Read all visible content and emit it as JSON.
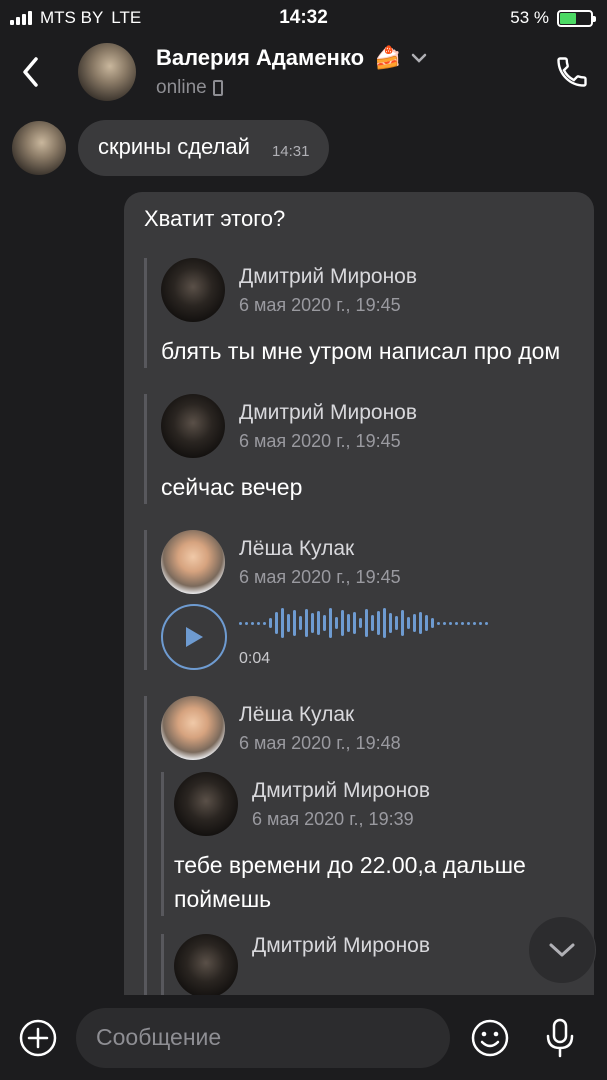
{
  "status_bar": {
    "carrier": "MTS BY",
    "network": "LTE",
    "time": "14:32",
    "battery_percent": "53 %",
    "battery_level": 0.53
  },
  "header": {
    "name": "Валерия Адаменко",
    "emoji": "🍰",
    "status": "online"
  },
  "messages": {
    "incoming": {
      "text": "скрины сделай",
      "time": "14:31"
    },
    "outgoing": {
      "text": "Хватит этого?",
      "forwards": [
        {
          "author": "Дмитрий Миронов",
          "date": "6 мая 2020 г., 19:45",
          "text": "блять ты мне утром написал про дом"
        },
        {
          "author": "Дмитрий Миронов",
          "date": "6 мая 2020 г., 19:45",
          "text": "сейчас вечер"
        },
        {
          "author": "Лёша Кулак",
          "date": "6 мая 2020 г., 19:45",
          "voice_duration": "0:04"
        },
        {
          "author": "Лёша Кулак",
          "date": "6 мая 2020 г., 19:48",
          "nested": [
            {
              "author": "Дмитрий Миронов",
              "date": "6 мая 2020 г., 19:39",
              "text": "тебе времени до 22.00,а дальше поймешь"
            },
            {
              "author": "Дмитрий Миронов"
            }
          ]
        }
      ]
    }
  },
  "composer": {
    "placeholder": "Сообщение"
  },
  "colors": {
    "background": "#1c1c1e",
    "bubble": "#3a3a3c",
    "accent": "#6e9bd1",
    "battery": "#4cd964"
  },
  "icons": [
    "back-icon",
    "chevron-down-icon",
    "phone-icon",
    "play-icon",
    "chevron-down-icon",
    "plus-icon",
    "emoji-icon",
    "mic-icon"
  ]
}
